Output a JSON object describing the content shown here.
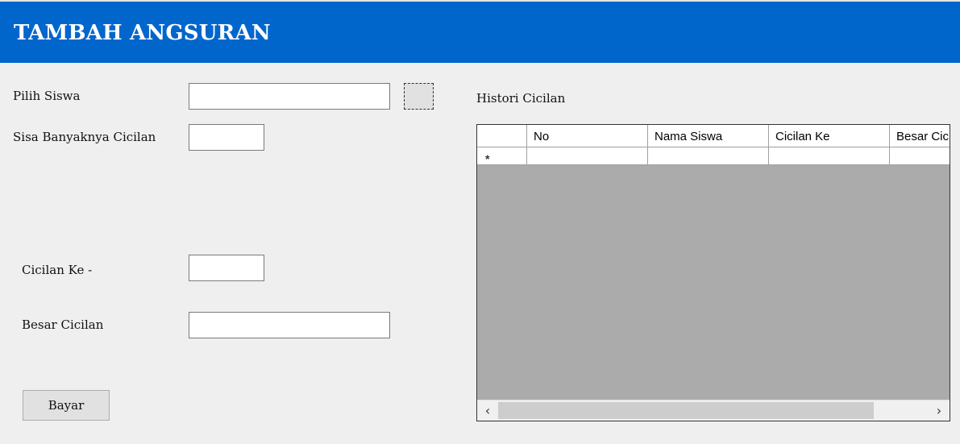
{
  "header": {
    "title": "TAMBAH ANGSURAN",
    "color": "#0066cc"
  },
  "form": {
    "pilih_siswa_label": "Pilih Siswa",
    "pilih_siswa_value": "",
    "sisa_cicilan_label": "Sisa Banyaknya Cicilan",
    "sisa_cicilan_value": "",
    "cicilan_ke_label": "Cicilan Ke -",
    "cicilan_ke_value": "",
    "besar_cicilan_label": "Besar Cicilan",
    "besar_cicilan_value": "",
    "bayar_label": "Bayar"
  },
  "histori": {
    "title": "Histori Cicilan",
    "columns": [
      "No",
      "Nama Siswa",
      "Cicilan Ke",
      "Besar Cicilan"
    ],
    "new_row_marker": "*",
    "scroll_left_icon": "chevron-left-icon",
    "scroll_right_icon": "chevron-right-icon"
  }
}
